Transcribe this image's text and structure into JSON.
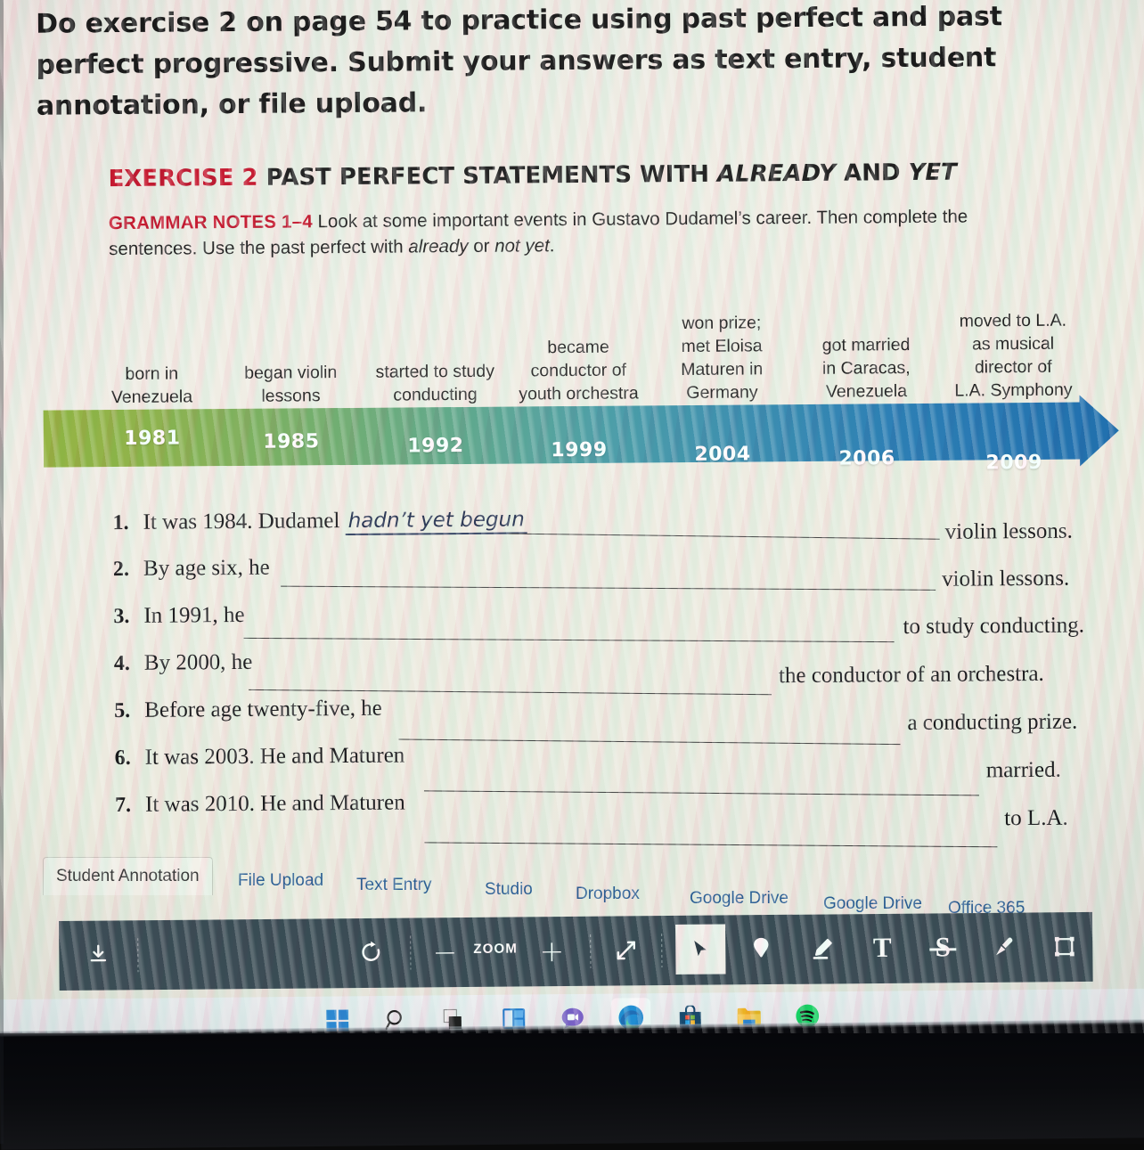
{
  "instruction": {
    "text": "Do exercise 2 on page 54 to practice using past perfect and past perfect progressive.  Submit your answers as text entry, student annotation, or file upload."
  },
  "workbook": {
    "exercise_label": "EXERCISE 2",
    "exercise_title_plain_1": "PAST PERFECT STATEMENTS WITH ",
    "exercise_title_italic_1": "ALREADY",
    "exercise_title_plain_2": " AND ",
    "exercise_title_italic_2": "YET",
    "grammar_notes_label": "GRAMMAR NOTES 1–4",
    "grammar_notes_text_1": "  Look at some important events in Gustavo Dudamel’s career. Then complete the sentences. Use the past perfect with ",
    "grammar_notes_italic_1": "already",
    "grammar_notes_text_2": " or ",
    "grammar_notes_italic_2": "not yet",
    "grammar_notes_text_3": ".",
    "timeline": {
      "colors": {
        "start": "#93b23f",
        "end": "#1f6fae",
        "year_text": "#ffffff"
      },
      "events": [
        {
          "year": "1981",
          "label": "born in\nVenezuela"
        },
        {
          "year": "1985",
          "label": "began violin\nlessons"
        },
        {
          "year": "1992",
          "label": "started to study\nconducting"
        },
        {
          "year": "1999",
          "label": "became\nconductor of\nyouth orchestra"
        },
        {
          "year": "2004",
          "label": "won prize;\nmet Eloisa\nMaturen in\nGermany"
        },
        {
          "year": "2006",
          "label": "got married\nin Caracas,\nVenezuela"
        },
        {
          "year": "2009",
          "label": "moved to L.A.\nas musical\ndirector of\nL.A. Symphony"
        }
      ]
    },
    "sentences": [
      {
        "num": "1.",
        "lead": "It was 1984. Dudamel ",
        "answer": "hadn’t yet begun",
        "tail": "violin lessons."
      },
      {
        "num": "2.",
        "lead": "By age six, he ",
        "answer": "",
        "tail": "violin lessons."
      },
      {
        "num": "3.",
        "lead": "In 1991, he ",
        "answer": "",
        "tail": "to study conducting."
      },
      {
        "num": "4.",
        "lead": "By 2000, he ",
        "answer": "",
        "tail": "the conductor of an orchestra."
      },
      {
        "num": "5.",
        "lead": "Before age twenty-five, he ",
        "answer": "",
        "tail": "a conducting prize."
      },
      {
        "num": "6.",
        "lead": "It was 2003. He and Maturen ",
        "answer": "",
        "tail": "married."
      },
      {
        "num": "7.",
        "lead": "It was 2010. He and Maturen ",
        "answer": "",
        "tail": "to L.A."
      }
    ]
  },
  "submission_tabs": {
    "items": [
      {
        "label": "Student Annotation",
        "active": true
      },
      {
        "label": "File Upload",
        "active": false
      },
      {
        "label": "Text Entry",
        "active": false
      },
      {
        "label": "Studio",
        "active": false
      },
      {
        "label": "Dropbox",
        "active": false
      },
      {
        "label": "Google Drive",
        "active": false
      },
      {
        "label": "Google Drive",
        "active": false
      },
      {
        "label": "Office 365",
        "active": false
      }
    ]
  },
  "annotation_toolbar": {
    "background_color": "#3b4c55",
    "zoom_label": "ZOOM",
    "tools": [
      {
        "name": "download-icon",
        "label": "Download"
      },
      {
        "name": "rotate-icon",
        "label": "Rotate"
      },
      {
        "name": "zoom-out-icon",
        "label": "−"
      },
      {
        "name": "zoom-label",
        "label": "ZOOM"
      },
      {
        "name": "zoom-in-icon",
        "label": "+"
      },
      {
        "name": "fullscreen-icon",
        "label": "Fullscreen"
      },
      {
        "name": "cursor-select-icon",
        "label": "Select",
        "selected": true
      },
      {
        "name": "pin-point-icon",
        "label": "Point"
      },
      {
        "name": "highlighter-icon",
        "label": "Highlight"
      },
      {
        "name": "text-tool-icon",
        "label": "T"
      },
      {
        "name": "strikethrough-icon",
        "label": "S"
      },
      {
        "name": "draw-pen-icon",
        "label": "Draw"
      },
      {
        "name": "area-box-icon",
        "label": "Area"
      }
    ]
  },
  "taskbar": {
    "items": [
      {
        "name": "windows-start-icon",
        "label": "Start"
      },
      {
        "name": "search-icon",
        "label": "Search"
      },
      {
        "name": "task-view-icon",
        "label": "Task View"
      },
      {
        "name": "widgets-icon",
        "label": "Widgets"
      },
      {
        "name": "chat-teams-icon",
        "label": "Chat"
      },
      {
        "name": "microsoft-edge-icon",
        "label": "Microsoft Edge",
        "active": true
      },
      {
        "name": "microsoft-store-icon",
        "label": "Microsoft Store"
      },
      {
        "name": "file-explorer-icon",
        "label": "File Explorer"
      },
      {
        "name": "spotify-icon",
        "label": "Spotify"
      }
    ]
  }
}
